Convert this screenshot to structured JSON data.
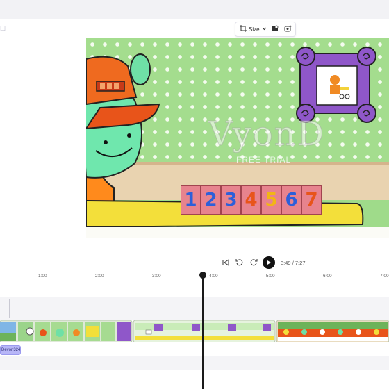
{
  "editor": {
    "corner_glyph": "☐"
  },
  "toolbar": {
    "size_label": "Size",
    "icons": [
      "crop-icon",
      "chevron-down-icon",
      "background-remove-icon",
      "magic-effects-icon"
    ]
  },
  "video": {
    "watermark": "VyonD",
    "watermark_sub": "FREE TRIAL",
    "number_blocks": [
      "1",
      "2",
      "3",
      "4",
      "5",
      "6",
      "7"
    ]
  },
  "player": {
    "current_time": "3:49",
    "total_time": "7:27",
    "time_separator": "/"
  },
  "ruler": {
    "ticks": [
      "1:00",
      "2:00",
      "3:00",
      "4:00",
      "5:00",
      "6:00",
      "7:00"
    ]
  },
  "audio_track": {
    "clip_label": "Devon324"
  },
  "colors": {
    "accent_audio": "#b7b6f7",
    "wall": "#a4dd8e",
    "desk": "#f3df3a"
  }
}
